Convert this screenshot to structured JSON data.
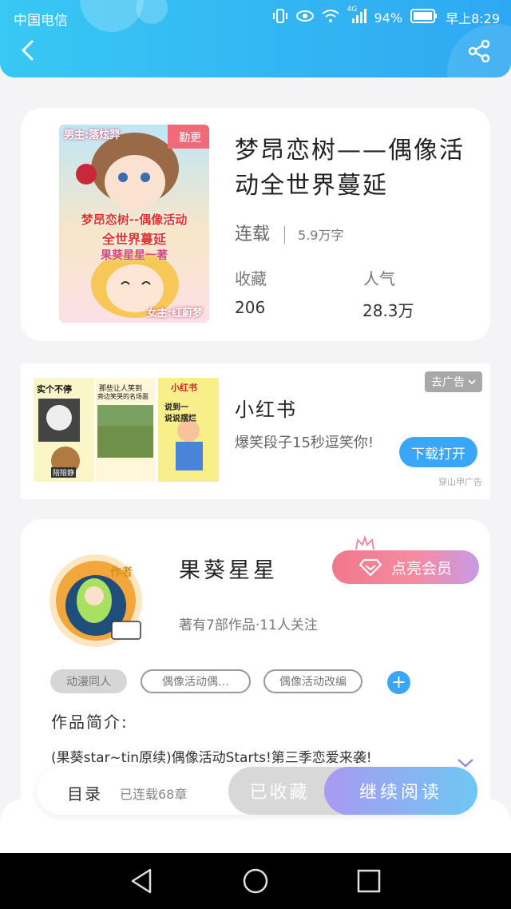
{
  "status_bar": {
    "carrier": "中国电信",
    "network": "4G",
    "battery": "94%",
    "time": "早上8:29"
  },
  "header": {
    "back_icon": "back-arrow-icon",
    "share_icon": "share-icon"
  },
  "book": {
    "cover_labels": {
      "badge": "勤更",
      "top": "男主:落炫羿",
      "title_line1": "梦昂恋树--偶像活动",
      "title_line2": "全世界蔓延",
      "author_line": "果葵星星一著",
      "bottom": "女主:红蔚梦"
    },
    "title": "梦昂恋树——偶像活动全世界蔓延",
    "status": "连载",
    "word_count": "5.9万字",
    "favorites_label": "收藏",
    "favorites_value": "206",
    "popularity_label": "人气",
    "popularity_value": "28.3万"
  },
  "ad": {
    "title": "小红书",
    "description": "爆笑段子15秒逗笑你!",
    "remove_label": "去广告",
    "download_label": "下载打开",
    "source": "穿山甲广告",
    "image_texts": {
      "img1_top": "实个不停",
      "img1_bottom": "陪陪静",
      "img2_top": "那些让人笑到",
      "img2_mid": "旁边笑哭的名场面",
      "img3_top": "小红书",
      "img3_mid": "说到一",
      "img3_mid2": "说说摆烂"
    }
  },
  "author": {
    "avatar_badge": "作者",
    "name": "果葵星星",
    "meta": "著有7部作品·11人关注",
    "vip_label": "点亮会员",
    "tags": [
      "动漫同人",
      "偶像活动偶…",
      "偶像活动改编"
    ],
    "intro_label": "作品简介:",
    "intro_text": "(果葵star~tin原续)偶像活动Starts!第三季恋爱来袭!"
  },
  "bottom_bar": {
    "toc_label": "目录",
    "chapter_count": "已连载68章",
    "favorited_label": "已收藏",
    "continue_label": "继续阅读"
  },
  "colors": {
    "header_start": "#38c8f4",
    "header_end": "#2ea8f2",
    "accent": "#3aa6f7",
    "vip_pink": "#f0788c"
  }
}
